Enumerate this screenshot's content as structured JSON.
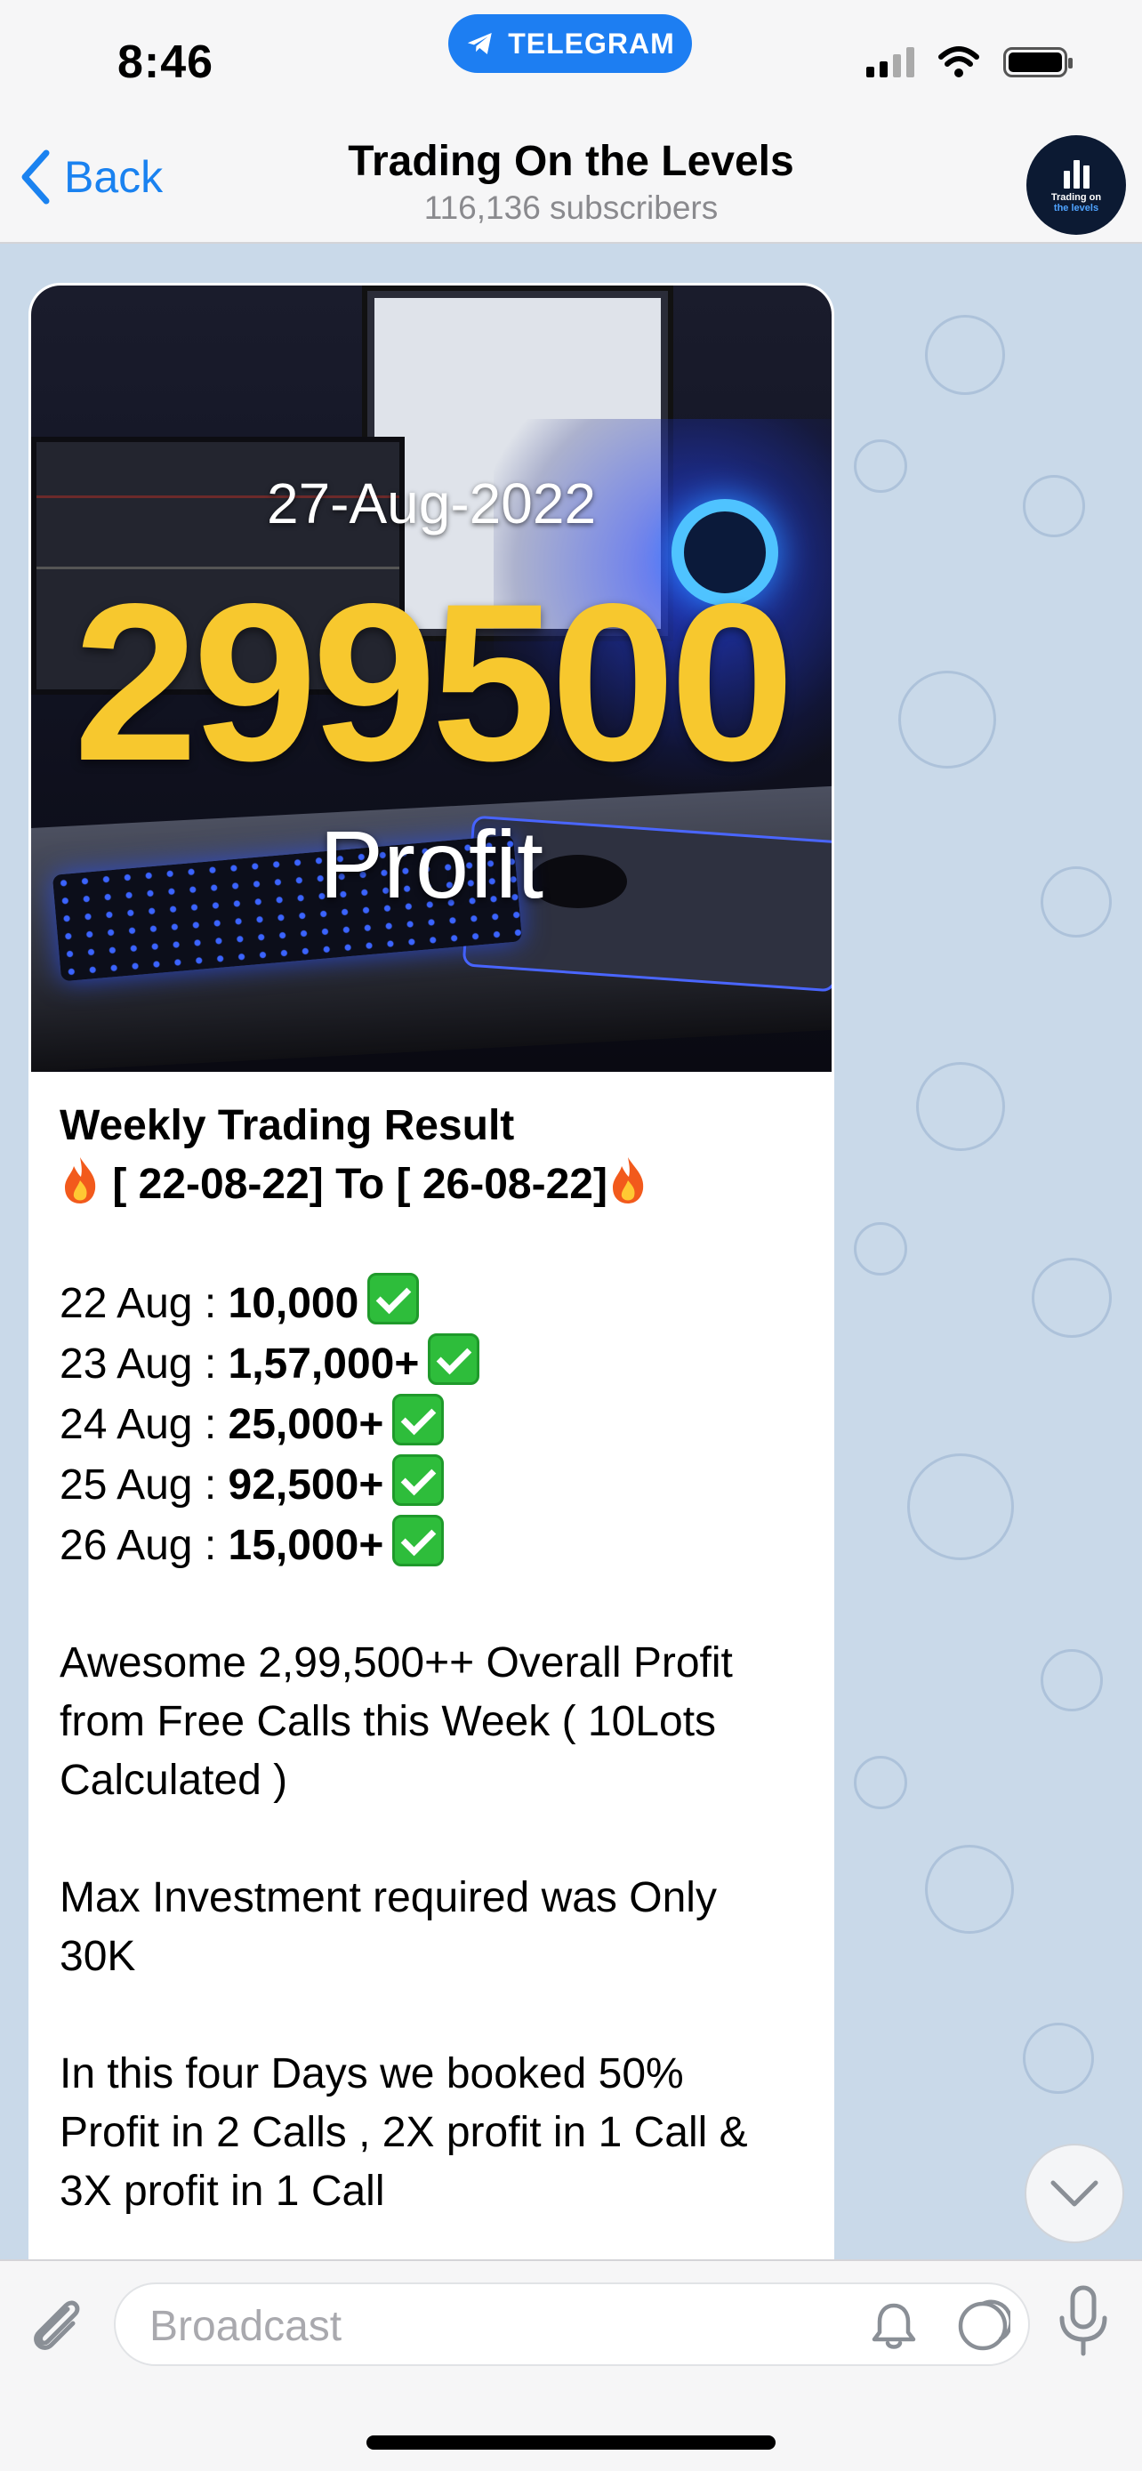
{
  "status_bar": {
    "time": "8:46",
    "app_pill": "TELEGRAM"
  },
  "header": {
    "back_label": "Back",
    "title": "Trading On the Levels",
    "subtitle": "116,136 subscribers",
    "avatar_line1": "Trading on",
    "avatar_line2": "the levels"
  },
  "photo": {
    "date": "27-Aug-2022",
    "amount": "299500",
    "label": "Profit"
  },
  "message": {
    "heading": "Weekly Trading Result",
    "range": " [ 22-08-22] To [ 26-08-22]",
    "days": [
      {
        "day": "22 Aug : ",
        "value": "10,000"
      },
      {
        "day": "23 Aug : ",
        "value": "1,57,000+"
      },
      {
        "day": "24 Aug : ",
        "value": "25,000+"
      },
      {
        "day": "25 Aug : ",
        "value": "92,500+"
      },
      {
        "day": "26 Aug : ",
        "value": "15,000+"
      }
    ],
    "para1_line1": "Awesome 2,99,500++  Overall Profit",
    "para1_line2": "from Free Calls this Week ( 10Lots",
    "para1_line3": "Calculated )",
    "para2_line1": "Max Investment required was Only",
    "para2_line2": "30K",
    "para3_line1": "In this four Days we booked 50%",
    "para3_line2": "Profit in 2 Calls , 2X profit in 1 Call &",
    "para3_line3": "3X profit in 1 Call"
  },
  "input": {
    "placeholder": "Broadcast"
  },
  "icons": {
    "pill_icon": "telegram-plane-icon",
    "back_icon": "chevron-left-icon",
    "attach_icon": "paperclip-icon",
    "bell_icon": "bell-icon",
    "moon_icon": "moon-icon",
    "mic_icon": "microphone-icon",
    "scroll_icon": "chevron-down-icon"
  },
  "colors": {
    "accent": "#1a82f0",
    "pill": "#1d7ef2",
    "amount": "#f7c82e",
    "check": "#2ebd3b",
    "chat_bg": "#c9d9e9"
  }
}
